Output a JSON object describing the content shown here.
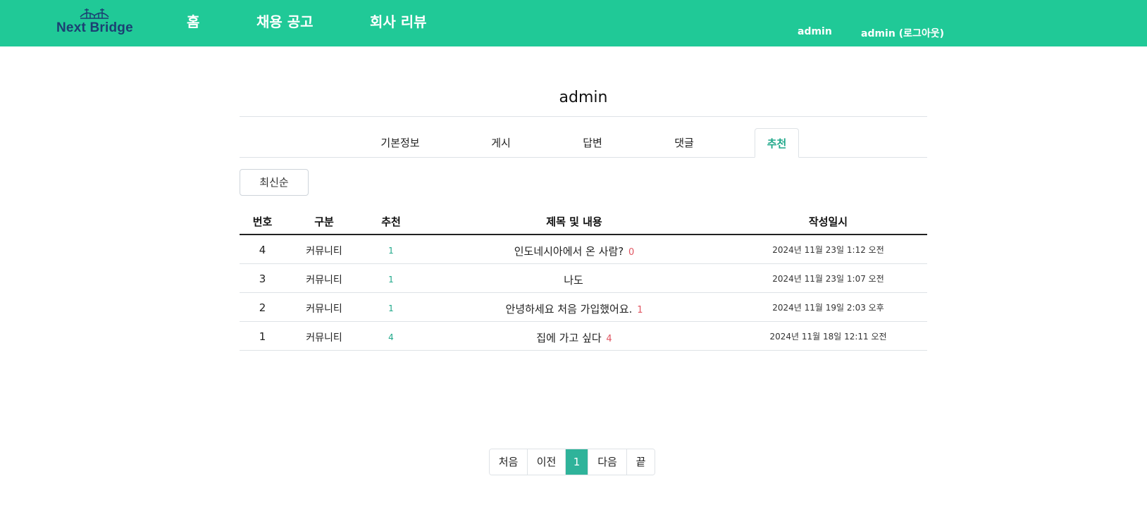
{
  "header": {
    "logo_text": "Next Bridge",
    "nav": [
      "홈",
      "채용 공고",
      "회사 리뷰"
    ],
    "user_name": "admin",
    "logout_label": "admin (로그아웃)"
  },
  "profile": {
    "title": "admin",
    "tabs": [
      "기본정보",
      "게시",
      "답변",
      "댓글",
      "추천"
    ],
    "active_tab": "추천",
    "sort_label": "최신순"
  },
  "table": {
    "headers": [
      "번호",
      "구분",
      "추천",
      "제목 및 내용",
      "작성일시"
    ],
    "rows": [
      {
        "num": "4",
        "type": "커뮤니티",
        "recommend": "1",
        "title": "인도네시아에서 온 사람?",
        "comments": "0",
        "date": "2024년 11월 23일 1:12 오전"
      },
      {
        "num": "3",
        "type": "커뮤니티",
        "recommend": "1",
        "title": "나도",
        "comments": "",
        "date": "2024년 11월 23일 1:07 오전"
      },
      {
        "num": "2",
        "type": "커뮤니티",
        "recommend": "1",
        "title": "안녕하세요 처음 가입했어요.",
        "comments": "1",
        "date": "2024년 11월 19일 2:03 오후"
      },
      {
        "num": "1",
        "type": "커뮤니티",
        "recommend": "4",
        "title": "집에 가고 싶다",
        "comments": "4",
        "date": "2024년 11월 18일 12:11 오전"
      }
    ]
  },
  "pagination": {
    "first": "처음",
    "prev": "이전",
    "current": "1",
    "next": "다음",
    "last": "끝"
  },
  "colors": {
    "header_bg": "#20c997",
    "accent": "#2fb39a",
    "comment_count": "#e05561"
  }
}
